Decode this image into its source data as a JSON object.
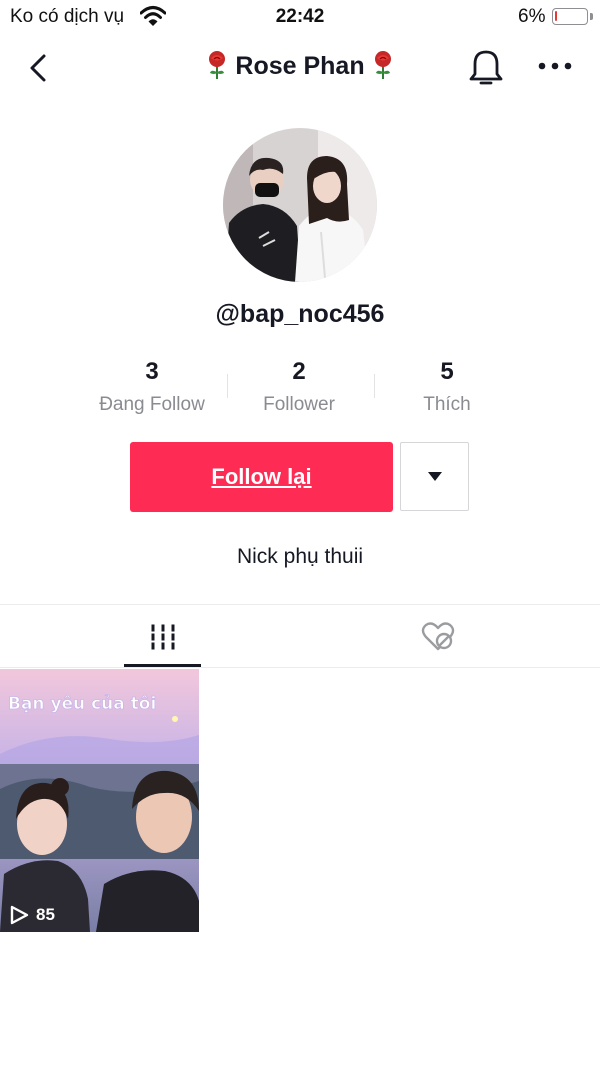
{
  "status_bar": {
    "carrier": "Ko có dịch vụ",
    "time": "22:42",
    "battery": "6%",
    "battery_level": 0.06
  },
  "nav": {
    "title": "Rose Phan"
  },
  "profile": {
    "username": "@bap_noc456",
    "bio": "Nick phụ thuii"
  },
  "stats": [
    {
      "value": "3",
      "label": "Đang Follow"
    },
    {
      "value": "2",
      "label": "Follower"
    },
    {
      "value": "5",
      "label": "Thích"
    }
  ],
  "actions": {
    "follow_label": "Follow lại"
  },
  "videos": [
    {
      "overlay_text": "Bạn yêu của tôi",
      "views": "85"
    }
  ],
  "colors": {
    "accent": "#fe2c55",
    "battery_low": "#e53935"
  }
}
